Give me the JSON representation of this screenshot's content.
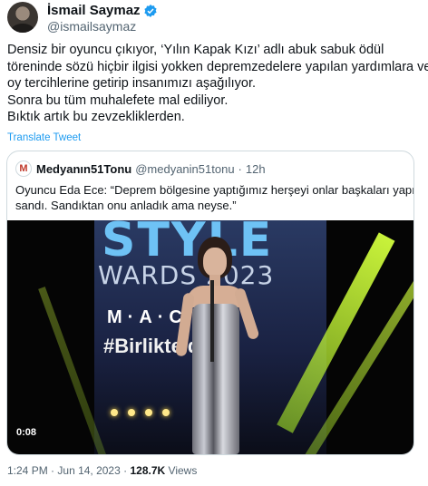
{
  "author": {
    "display_name": "İsmail Saymaz",
    "handle": "@ismailsaymaz",
    "verified_icon": "verified-badge-icon",
    "verified_color": "#1d9bf0"
  },
  "tweet": {
    "lines": [
      "Densiz bir oyuncu çıkıyor, ‘Yılın Kapak Kızı’ adlı abuk sabuk ödül",
      "töreninde sözü hiçbir ilgisi yokken depremzedelere yapılan yardımlara ve",
      "oy tercihlerine getirip insanımızı aşağılıyor.",
      "Sonra bu tüm muhalefete mal ediliyor.",
      "Bıktık artık bu zevzekliklerden."
    ],
    "translate_label": "Translate Tweet"
  },
  "quoted_tweet": {
    "avatar_letter": "M",
    "display_name": "Medyanın51Tonu",
    "handle": "@medyanin51tonu",
    "separator": "·",
    "time": "12h",
    "lines": [
      "Oyuncu Eda Ece: “Deprem bölgesine yaptığımız herşeyi onlar başkaları yapıyor",
      "sandı. Sandıktan onu anladık ama neyse.”"
    ],
    "video": {
      "duration": "0:08",
      "stage_text": {
        "style": "STYLE",
        "awards": "WARDS 2023",
        "brand": "M·A·C",
        "hashtag": "#Birlikte     don"
      }
    }
  },
  "meta": {
    "time": "1:24 PM",
    "separator": "·",
    "date": "Jun 14, 2023",
    "views_count": "128.7K",
    "views_label": "Views"
  },
  "colors": {
    "link": "#1d9bf0",
    "secondary_text": "#536471",
    "border": "#cfd9de"
  }
}
